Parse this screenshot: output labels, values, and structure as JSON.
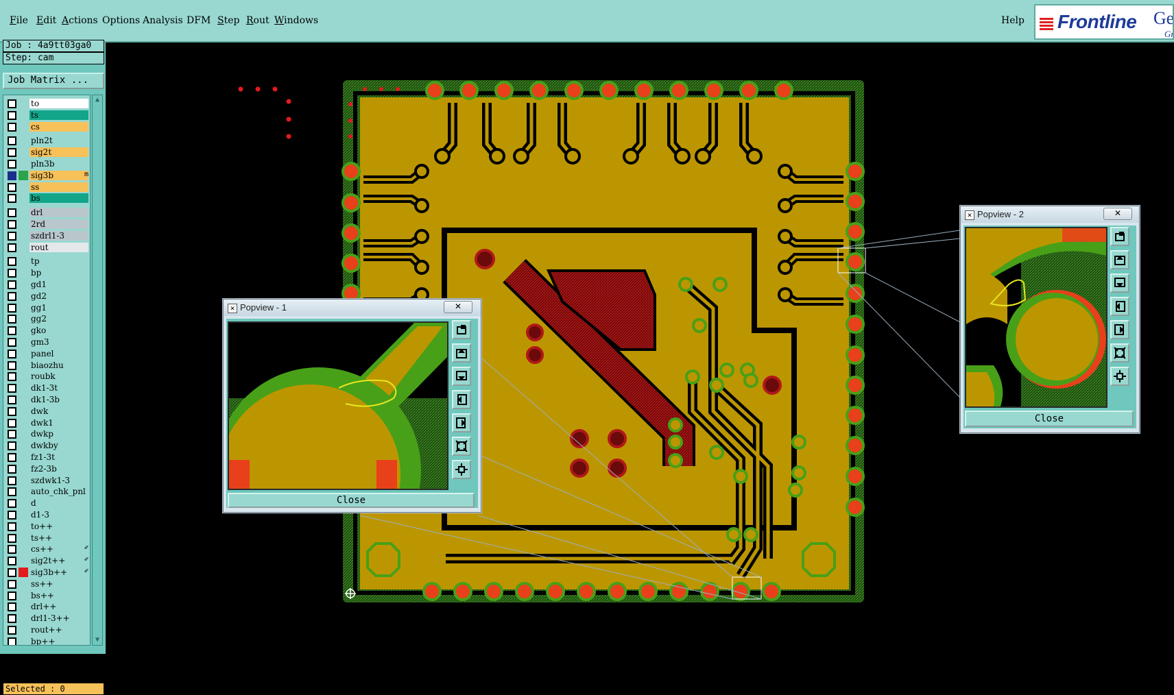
{
  "menubar": {
    "items": [
      {
        "label": "File",
        "underline": "F",
        "rest": "ile"
      },
      {
        "label": "Edit",
        "underline": "E",
        "rest": "dit"
      },
      {
        "label": "Actions",
        "underline": "A",
        "rest": "ctions"
      },
      {
        "label": "Options",
        "underline": "",
        "rest": "Options"
      },
      {
        "label": "Analysis",
        "underline": "",
        "rest": "Analysis"
      },
      {
        "label": "DFM",
        "underline": "",
        "rest": "DFM"
      },
      {
        "label": "Step",
        "underline": "S",
        "rest": "tep"
      },
      {
        "label": "Rout",
        "underline": "R",
        "rest": "out"
      },
      {
        "label": "Windows",
        "underline": "W",
        "rest": "indows"
      }
    ],
    "help": "Help"
  },
  "logo": {
    "name": "Frontline",
    "extra": "Ge",
    "extra2": "Gr"
  },
  "job": {
    "job_line": "Job : 4a9tt03ga0",
    "step_line": "Step: cam",
    "matrix_button": "Job Matrix ..."
  },
  "layers": [
    {
      "name": "to",
      "color": "#ffffff",
      "swatch": ""
    },
    {
      "name": "ts",
      "color": "#13a58a",
      "swatch": ""
    },
    {
      "name": "cs",
      "color": "#f7c15a",
      "swatch": ""
    },
    {
      "name": "pln2t",
      "color": "#98d8d0",
      "swatch": ""
    },
    {
      "name": "sig2t",
      "color": "#f7c15a",
      "swatch": ""
    },
    {
      "name": "pln3b",
      "color": "#98d8d0",
      "swatch": ""
    },
    {
      "name": "sig3b",
      "color": "#f7c15a",
      "swatch": "#2aa34a",
      "mark": "m",
      "active": true
    },
    {
      "name": "ss",
      "color": "#f7c15a",
      "swatch": ""
    },
    {
      "name": "bs",
      "color": "#13a58a",
      "swatch": ""
    },
    {
      "name": "drl",
      "color": "#b9c6cc",
      "swatch": ""
    },
    {
      "name": "2rd",
      "color": "#b9c6cc",
      "swatch": ""
    },
    {
      "name": "szdrl1-3",
      "color": "#b9c6cc",
      "swatch": ""
    },
    {
      "name": "rout",
      "color": "#e4e8ea",
      "swatch": ""
    },
    {
      "name": "tp",
      "color": "#98d8d0",
      "swatch": ""
    },
    {
      "name": "bp",
      "color": "#98d8d0",
      "swatch": ""
    },
    {
      "name": "gd1",
      "color": "#98d8d0",
      "swatch": ""
    },
    {
      "name": "gd2",
      "color": "#98d8d0",
      "swatch": ""
    },
    {
      "name": "gg1",
      "color": "#98d8d0",
      "swatch": ""
    },
    {
      "name": "gg2",
      "color": "#98d8d0",
      "swatch": ""
    },
    {
      "name": "gko",
      "color": "#98d8d0",
      "swatch": ""
    },
    {
      "name": "gm3",
      "color": "#98d8d0",
      "swatch": ""
    },
    {
      "name": "panel",
      "color": "#98d8d0",
      "swatch": ""
    },
    {
      "name": "biaozhu",
      "color": "#98d8d0",
      "swatch": ""
    },
    {
      "name": "roubk",
      "color": "#98d8d0",
      "swatch": ""
    },
    {
      "name": "dk1-3t",
      "color": "#98d8d0",
      "swatch": ""
    },
    {
      "name": "dk1-3b",
      "color": "#98d8d0",
      "swatch": ""
    },
    {
      "name": "dwk",
      "color": "#98d8d0",
      "swatch": ""
    },
    {
      "name": "dwk1",
      "color": "#98d8d0",
      "swatch": ""
    },
    {
      "name": "dwkp",
      "color": "#98d8d0",
      "swatch": ""
    },
    {
      "name": "dwkby",
      "color": "#98d8d0",
      "swatch": ""
    },
    {
      "name": "fz1-3t",
      "color": "#98d8d0",
      "swatch": ""
    },
    {
      "name": "fz2-3b",
      "color": "#98d8d0",
      "swatch": ""
    },
    {
      "name": "szdwk1-3",
      "color": "#98d8d0",
      "swatch": ""
    },
    {
      "name": "auto_chk_pnl",
      "color": "#98d8d0",
      "swatch": ""
    },
    {
      "name": "d",
      "color": "#98d8d0",
      "swatch": ""
    },
    {
      "name": "d1-3",
      "color": "#98d8d0",
      "swatch": ""
    },
    {
      "name": "to++",
      "color": "#98d8d0",
      "swatch": ""
    },
    {
      "name": "ts++",
      "color": "#98d8d0",
      "swatch": ""
    },
    {
      "name": "cs++",
      "color": "#98d8d0",
      "swatch": "",
      "mark": "✐"
    },
    {
      "name": "sig2t++",
      "color": "#98d8d0",
      "swatch": "",
      "mark": "✐"
    },
    {
      "name": "sig3b++",
      "color": "#98d8d0",
      "swatch": "#e41b1b",
      "mark": "✐"
    },
    {
      "name": "ss++",
      "color": "#98d8d0",
      "swatch": ""
    },
    {
      "name": "bs++",
      "color": "#98d8d0",
      "swatch": ""
    },
    {
      "name": "drl++",
      "color": "#98d8d0",
      "swatch": ""
    },
    {
      "name": "drl1-3++",
      "color": "#98d8d0",
      "swatch": ""
    },
    {
      "name": "rout++",
      "color": "#98d8d0",
      "swatch": ""
    },
    {
      "name": "bp++",
      "color": "#98d8d0",
      "swatch": ""
    }
  ],
  "selected": "Selected : 0",
  "popview1": {
    "title": "Popview - 1",
    "close": "Close"
  },
  "popview2": {
    "title": "Popview - 2",
    "close": "Close"
  },
  "colors": {
    "copper": "#bc9600",
    "pad_ring": "#48a018",
    "drill_red": "#e8401a",
    "trace_red": "#8a1010",
    "hatch": "#2e6c18",
    "highlight": "#e8e820"
  }
}
